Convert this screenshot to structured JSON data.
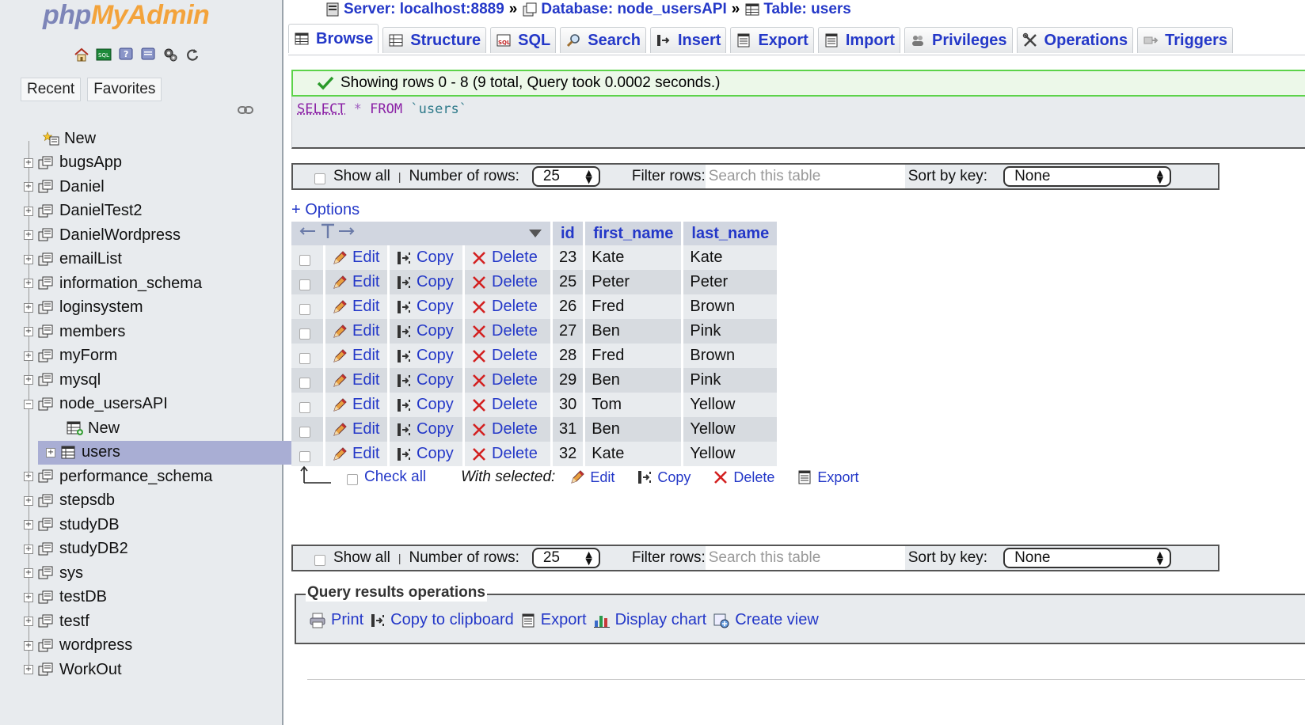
{
  "logo": {
    "part1": "php",
    "part2": "MyAdmin"
  },
  "sidebar": {
    "nav_icons": [
      "home-icon",
      "sql-query-icon",
      "help-icon",
      "docs-icon",
      "settings-icon",
      "reload-icon"
    ],
    "tabs": [
      "Recent",
      "Favorites"
    ],
    "tree": [
      {
        "label": "New",
        "type": "new"
      },
      {
        "label": "bugsApp"
      },
      {
        "label": "Daniel"
      },
      {
        "label": "DanielTest2"
      },
      {
        "label": "DanielWordpress"
      },
      {
        "label": "emailList"
      },
      {
        "label": "information_schema"
      },
      {
        "label": "loginsystem"
      },
      {
        "label": "members"
      },
      {
        "label": "myForm"
      },
      {
        "label": "mysql"
      },
      {
        "label": "node_usersAPI",
        "expanded": true
      },
      {
        "label": "New",
        "child": true,
        "type": "new"
      },
      {
        "label": "users",
        "child": true,
        "selected": true
      },
      {
        "label": "performance_schema"
      },
      {
        "label": "stepsdb"
      },
      {
        "label": "studyDB"
      },
      {
        "label": "studyDB2"
      },
      {
        "label": "sys"
      },
      {
        "label": "testDB"
      },
      {
        "label": "testf"
      },
      {
        "label": "wordpress"
      },
      {
        "label": "WorkOut"
      }
    ]
  },
  "breadcrumb": {
    "server": "Server: localhost:8889",
    "database": "Database: node_usersAPI",
    "table": "Table: users",
    "sep": "»"
  },
  "tabs": [
    "Browse",
    "Structure",
    "SQL",
    "Search",
    "Insert",
    "Export",
    "Import",
    "Privileges",
    "Operations",
    "Triggers"
  ],
  "message": "Showing rows 0 - 8 (9 total, Query took 0.0002 seconds.)",
  "sql": {
    "select": "SELECT",
    "star": "*",
    "from": "FROM",
    "table": "`users`"
  },
  "navbar": {
    "show_all": "Show all",
    "rows_label": "Number of rows:",
    "rows_value": "25",
    "filter_label": "Filter rows:",
    "filter_placeholder": "Search this table",
    "sort_label": "Sort by key:",
    "sort_value": "None"
  },
  "options_link": "+ Options",
  "grid": {
    "columns": [
      "id",
      "first_name",
      "last_name"
    ],
    "actions": {
      "edit": "Edit",
      "copy": "Copy",
      "delete": "Delete"
    },
    "rows": [
      [
        "23",
        "Kate",
        "Kate"
      ],
      [
        "25",
        "Peter",
        "Peter"
      ],
      [
        "26",
        "Fred",
        "Brown"
      ],
      [
        "27",
        "Ben",
        "Pink"
      ],
      [
        "28",
        "Fred",
        "Brown"
      ],
      [
        "29",
        "Ben",
        "Pink"
      ],
      [
        "30",
        "Tom",
        "Yellow"
      ],
      [
        "31",
        "Ben",
        "Yellow"
      ],
      [
        "32",
        "Kate",
        "Yellow"
      ]
    ]
  },
  "bulk": {
    "check_all": "Check all",
    "with_selected": "With selected:",
    "edit": "Edit",
    "copy": "Copy",
    "delete": "Delete",
    "export": "Export"
  },
  "qro": {
    "legend": "Query results operations",
    "print": "Print",
    "copy": "Copy to clipboard",
    "export": "Export",
    "chart": "Display chart",
    "view": "Create view"
  },
  "colors": {
    "link": "#2438c8",
    "success_border": "#5cd34a",
    "delete_red": "#d32020",
    "selected_row": "#a9aed4"
  }
}
